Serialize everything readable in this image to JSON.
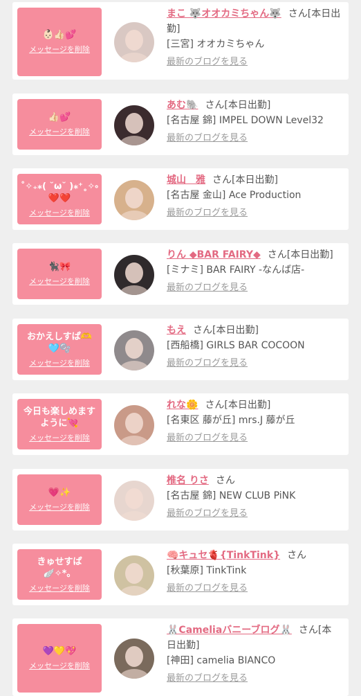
{
  "common": {
    "delete_label": "メッセージを削除",
    "blog_label": "最新のブログを見る"
  },
  "items": [
    {
      "message": "👶🏻👍🏻💕",
      "name": "まこ 🐺オオカミちゃん🐺",
      "suffix": "さん[本日出勤]",
      "shop": "[三宮] オオカミちゃん",
      "avatar_color": "#d9c8c3"
    },
    {
      "message": "👍🏻💕",
      "name": "あむ🐘",
      "suffix": "さん[本日出勤]",
      "shop": "[名古屋 錦] IMPEL DOWN Level32",
      "avatar_color": "#3b2b2e"
    },
    {
      "message": "˚✧₊⁎( ˘ω˘ )⁎⁺˳✧༚ ❤️❤️",
      "name": "城山　雅",
      "suffix": "さん[本日出勤]",
      "shop": "[名古屋 金山] Ace Production",
      "avatar_color": "#d7b18c"
    },
    {
      "message": "🐈‍⬛🎀",
      "name": "りん ◆BAR FAIRY◆",
      "suffix": "さん[本日出勤]",
      "shop": "[ミナミ] BAR FAIRY -なんば店-",
      "avatar_color": "#2f2a2c"
    },
    {
      "message": "おかえしすぱ🫶\n🩵🫧",
      "name": "もえ",
      "suffix": "さん[本日出勤]",
      "shop": "[西船橋] GIRLS BAR COCOON",
      "avatar_color": "#8f8a8c"
    },
    {
      "message": "今日も楽しめます\nように💘",
      "name": "れな🌼",
      "suffix": "さん[本日出勤]",
      "shop": "[名東区 藤が丘] mrs.J 藤が丘",
      "avatar_color": "#c99a88"
    },
    {
      "message": "💗✨",
      "name": "椎名 りさ",
      "suffix": "さん",
      "shop": "[名古屋 錦] NEW CLUB PiNK",
      "avatar_color": "#e7d6cf"
    },
    {
      "message": "きゅせすぱ\n🪽✧*。",
      "name": "🧠キュセ🫀{TinkTink}",
      "suffix": "さん",
      "shop": "[秋葉原] TinkTink",
      "avatar_color": "#cfc2a2"
    },
    {
      "message": "💜💛💖",
      "name": "🐰Cameliaバニーブログ🐰",
      "suffix": "さん[本日出勤]",
      "shop": "[神田] camelia BIANCO",
      "avatar_color": "#7a6a5c"
    }
  ]
}
